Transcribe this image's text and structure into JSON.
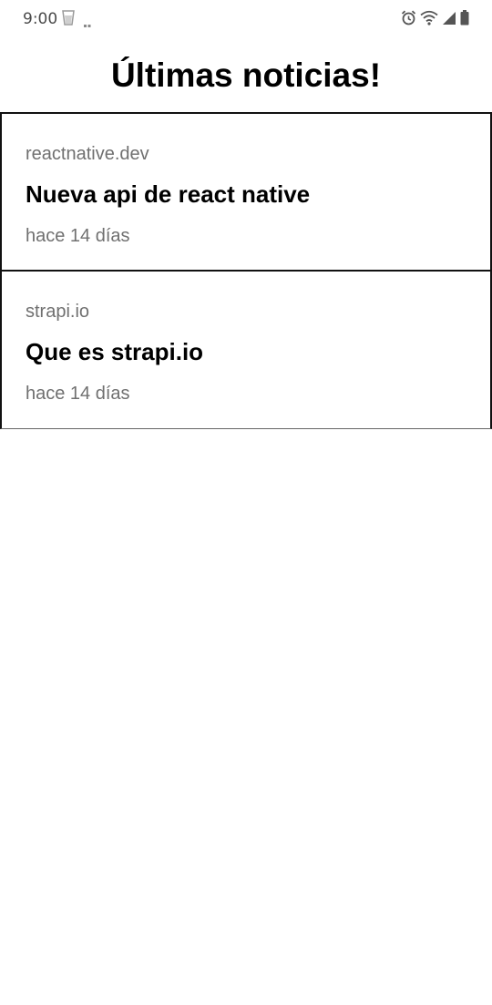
{
  "status_bar": {
    "time": "9:00",
    "icons": [
      "cup-icon",
      "dots-icon",
      "alarm-icon",
      "wifi-icon",
      "signal-icon",
      "battery-icon"
    ]
  },
  "header": {
    "title": "Últimas noticias!"
  },
  "news": [
    {
      "source": "reactnative.dev",
      "title": "Nueva api de react native",
      "time": "hace 14 días"
    },
    {
      "source": "strapi.io",
      "title": "Que es strapi.io",
      "time": "hace 14 días"
    }
  ]
}
